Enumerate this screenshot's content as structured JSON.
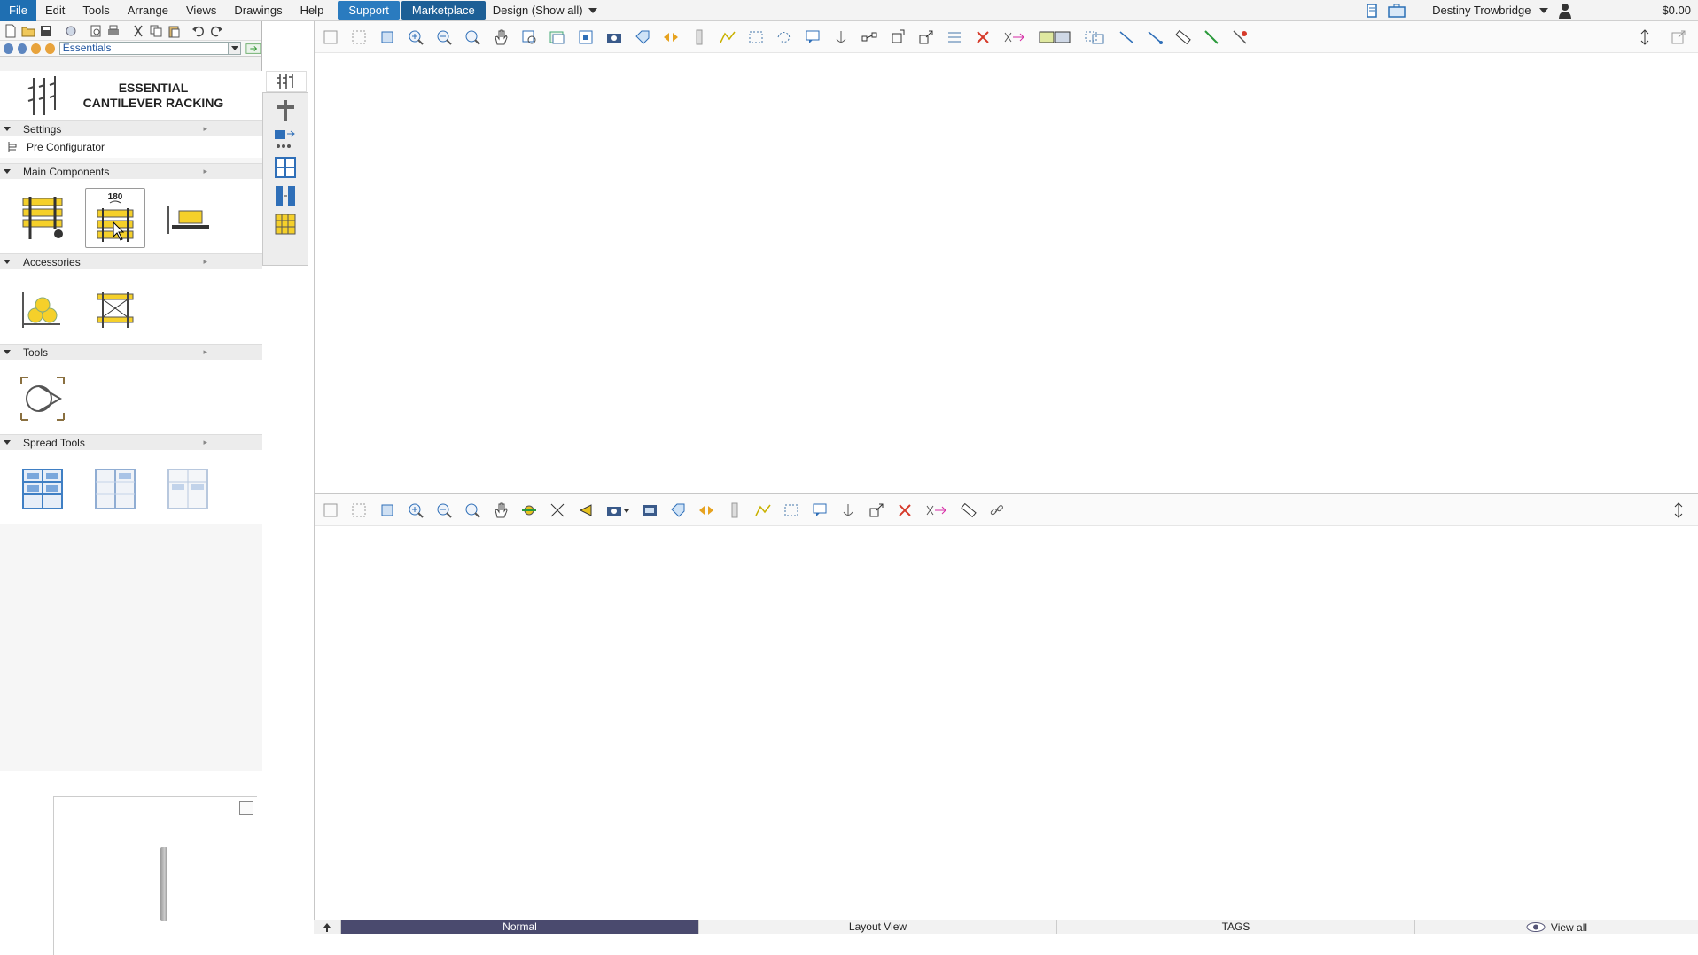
{
  "menubar": {
    "items": [
      "File",
      "Edit",
      "Tools",
      "Arrange",
      "Views",
      "Drawings",
      "Help"
    ],
    "support_label": "Support",
    "marketplace_label": "Marketplace",
    "design_label": "Design (Show all)",
    "user_name": "Destiny Trowbridge",
    "balance": "$0.00"
  },
  "library": {
    "selected": "Essentials"
  },
  "catalog": {
    "title": "ESSENTIAL CANTILEVER RACKING",
    "sections": {
      "settings": "Settings",
      "pre_configurator": "Pre Configurator",
      "main_components": "Main Components",
      "accessories": "Accessories",
      "tools": "Tools",
      "spread_tools": "Spread Tools"
    },
    "rotate_badge": "180"
  },
  "statusbar": {
    "tabs": [
      "Normal",
      "Layout View",
      "TAGS"
    ],
    "view_all": "View all"
  },
  "colors": {
    "accent": "#2a7bbf",
    "rack_yellow": "#f5d02a",
    "spread_blue": "#3f7fc4"
  }
}
